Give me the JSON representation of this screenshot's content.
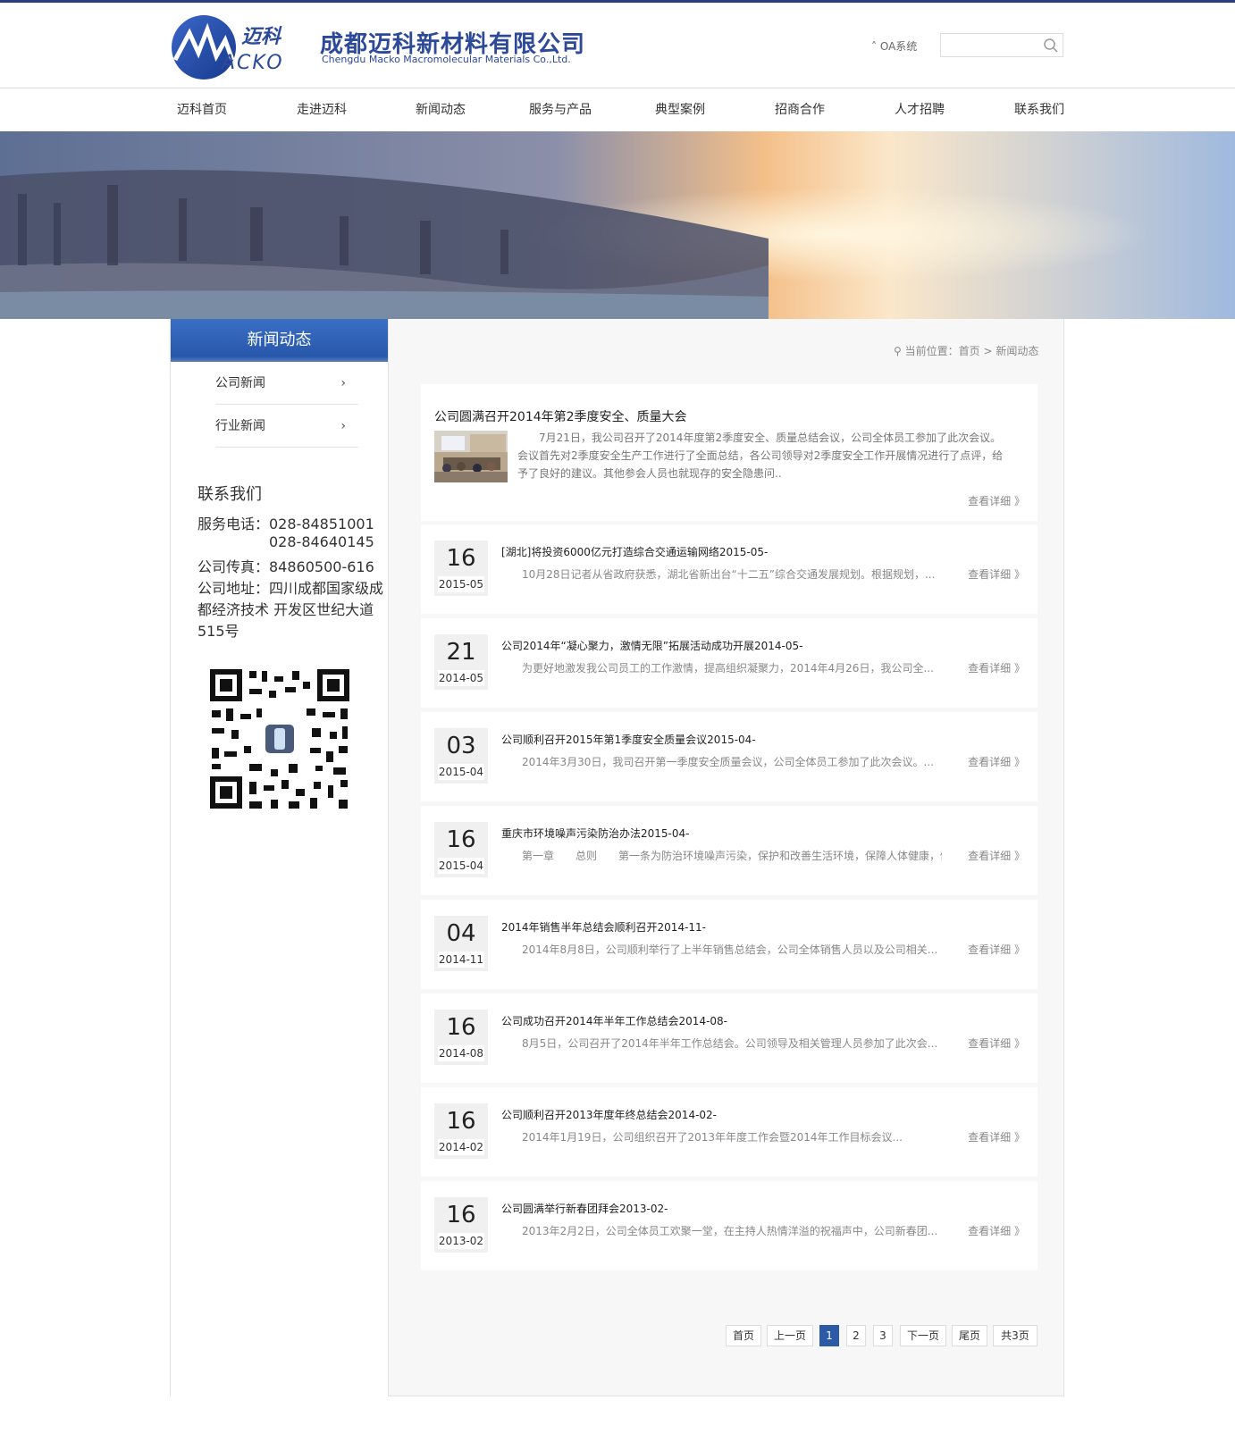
{
  "header": {
    "logo_text": "迈科 MACKO",
    "company_cn": "成都迈科新材料有限公司",
    "company_en": "Chengdu Macko Macromolecular Materials Co.,Ltd.",
    "oa_label": "OA系统",
    "search_placeholder": ""
  },
  "nav": {
    "items": [
      "迈科首页",
      "走进迈科",
      "新闻动态",
      "服务与产品",
      "典型案例",
      "招商合作",
      "人才招聘",
      "联系我们"
    ]
  },
  "sidebar": {
    "title": "新闻动态",
    "links": [
      "公司新闻",
      "行业新闻"
    ],
    "contact_title": "联系我们",
    "contact_lines": [
      "服务电话：028-84851001",
      "028-84640145",
      "公司传真：84860500-616",
      "公司地址：四川成都国家级成",
      "都经济技术 开发区世纪大道",
      "515号"
    ]
  },
  "breadcrumb": {
    "prefix": "当前位置：",
    "home": "首页",
    "sep": ">",
    "current": "新闻动态"
  },
  "featured": {
    "title": "公司圆满召开2014年第2季度安全、质量大会",
    "desc": "7月21日，我公司召开了2014年度第2季度安全、质量总结会议，公司全体员工参加了此次会议。会议首先对2季度安全生产工作进行了全面总结，各公司领导对2季度安全工作开展情况进行了点评，给予了良好的建议。其他参会人员也就现存的安全隐患问..",
    "detail": "查看详细 》"
  },
  "news": [
    {
      "day": "16",
      "ym": "2015-05",
      "title": "[湖北]将投资6000亿元打造综合交通运输网络2015-05-",
      "desc": "10月28日记者从省政府获悉，湖北省新出台“十二五”综合交通发展规划。根据规划，...",
      "detail": "查看详细 》"
    },
    {
      "day": "21",
      "ym": "2014-05",
      "title": "公司2014年“凝心聚力，激情无限”拓展活动成功开展2014-05-",
      "desc": "为更好地激发我公司员工的工作激情，提高组织凝聚力，2014年4月26日，我公司全...",
      "detail": "查看详细 》"
    },
    {
      "day": "03",
      "ym": "2015-04",
      "title": "公司顺利召开2015年第1季度安全质量会议2015-04-",
      "desc": "2014年3月30日，我司召开第一季度安全质量会议，公司全体员工参加了此次会议。...",
      "detail": "查看详细 》"
    },
    {
      "day": "16",
      "ym": "2015-04",
      "title": "重庆市环境噪声污染防治办法2015-04-",
      "desc": "第一章　　总则　　第一条为防治环境噪声污染，保护和改善生活环境，保障人体健康，促...",
      "detail": "查看详细 》"
    },
    {
      "day": "04",
      "ym": "2014-11",
      "title": "2014年销售半年总结会顺利召开2014-11-",
      "desc": "2014年8月8日，公司顺利举行了上半年销售总结会，公司全体销售人员以及公司相关...",
      "detail": "查看详细 》"
    },
    {
      "day": "16",
      "ym": "2014-08",
      "title": "公司成功召开2014年半年工作总结会2014-08-",
      "desc": "8月5日，公司召开了2014年半年工作总结会。公司领导及相关管理人员参加了此次会...",
      "detail": "查看详细 》"
    },
    {
      "day": "16",
      "ym": "2014-02",
      "title": "公司顺利召开2013年度年终总结会2014-02-",
      "desc": "2014年1月19日，公司组织召开了2013年年度工作会暨2014年工作目标会议...",
      "detail": "查看详细 》"
    },
    {
      "day": "16",
      "ym": "2013-02",
      "title": "公司圆满举行新春团拜会2013-02-",
      "desc": "2013年2月2日，公司全体员工欢聚一堂，在主持人热情洋溢的祝福声中，公司新春团...",
      "detail": "查看详细 》"
    }
  ],
  "pager": {
    "first": "首页",
    "prev": "上一页",
    "pages": [
      "1",
      "2",
      "3"
    ],
    "next": "下一页",
    "last": "尾页",
    "total": "共3页"
  },
  "colors": {
    "brand_blue": "#2d4a9a",
    "sidebar_title_bg": "#2d5aa6",
    "active_page": "#2d5aa6"
  }
}
